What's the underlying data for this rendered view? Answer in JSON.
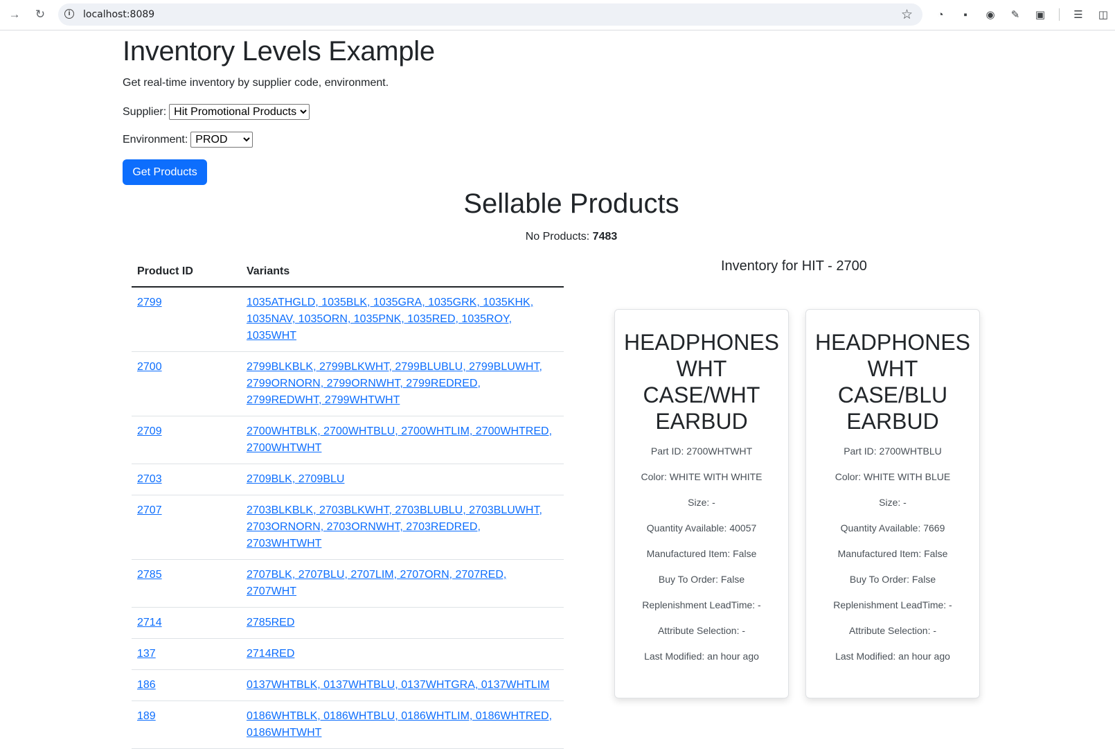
{
  "browser": {
    "url": "localhost:8089"
  },
  "page": {
    "title": "Inventory Levels Example",
    "subtitle": "Get real-time inventory by supplier code, environment.",
    "supplier_label": "Supplier:",
    "supplier_value": "Hit Promotional Products",
    "environment_label": "Environment:",
    "environment_value": "PROD",
    "get_products_label": "Get Products",
    "section_title": "Sellable Products",
    "count_label": "No Products:",
    "count_value": "7483"
  },
  "table": {
    "headers": [
      "Product ID",
      "Variants"
    ],
    "rows": [
      {
        "id": "2799",
        "variants": "1035ATHGLD, 1035BLK, 1035GRA, 1035GRK, 1035KHK, 1035NAV, 1035ORN, 1035PNK, 1035RED, 1035ROY, 1035WHT"
      },
      {
        "id": "2700",
        "variants": "2799BLKBLK, 2799BLKWHT, 2799BLUBLU, 2799BLUWHT, 2799ORNORN, 2799ORNWHT, 2799REDRED, 2799REDWHT, 2799WHTWHT"
      },
      {
        "id": "2709",
        "variants": "2700WHTBLK, 2700WHTBLU, 2700WHTLIM, 2700WHTRED, 2700WHTWHT"
      },
      {
        "id": "2703",
        "variants": "2709BLK, 2709BLU"
      },
      {
        "id": "2707",
        "variants": "2703BLKBLK, 2703BLKWHT, 2703BLUBLU, 2703BLUWHT, 2703ORNORN, 2703ORNWHT, 2703REDRED, 2703WHTWHT"
      },
      {
        "id": "2785",
        "variants": "2707BLK, 2707BLU, 2707LIM, 2707ORN, 2707RED, 2707WHT"
      },
      {
        "id": "2714",
        "variants": "2785RED"
      },
      {
        "id": "137",
        "variants": "2714RED"
      },
      {
        "id": "186",
        "variants": "0137WHTBLK, 0137WHTBLU, 0137WHTGRA, 0137WHTLIM"
      },
      {
        "id": "189",
        "variants": "0186WHTBLK, 0186WHTBLU, 0186WHTLIM, 0186WHTRED, 0186WHTWHT"
      }
    ]
  },
  "inventory": {
    "title": "Inventory for HIT - 2700",
    "cards": [
      {
        "name": "HEADPHONES WHT CASE/WHT EARBUD",
        "part_id": "Part ID: 2700WHTWHT",
        "color": "Color: WHITE WITH WHITE",
        "size": "Size: -",
        "quantity": "Quantity Available: 40057",
        "manufactured": "Manufactured Item: False",
        "buy_to_order": "Buy To Order: False",
        "leadtime": "Replenishment LeadTime: -",
        "attribute": "Attribute Selection: -",
        "modified": "Last Modified: an hour ago"
      },
      {
        "name": "HEADPHONES WHT CASE/BLU EARBUD",
        "part_id": "Part ID: 2700WHTBLU",
        "color": "Color: WHITE WITH BLUE",
        "size": "Size: -",
        "quantity": "Quantity Available: 7669",
        "manufactured": "Manufactured Item: False",
        "buy_to_order": "Buy To Order: False",
        "leadtime": "Replenishment LeadTime: -",
        "attribute": "Attribute Selection: -",
        "modified": "Last Modified: an hour ago"
      }
    ]
  }
}
